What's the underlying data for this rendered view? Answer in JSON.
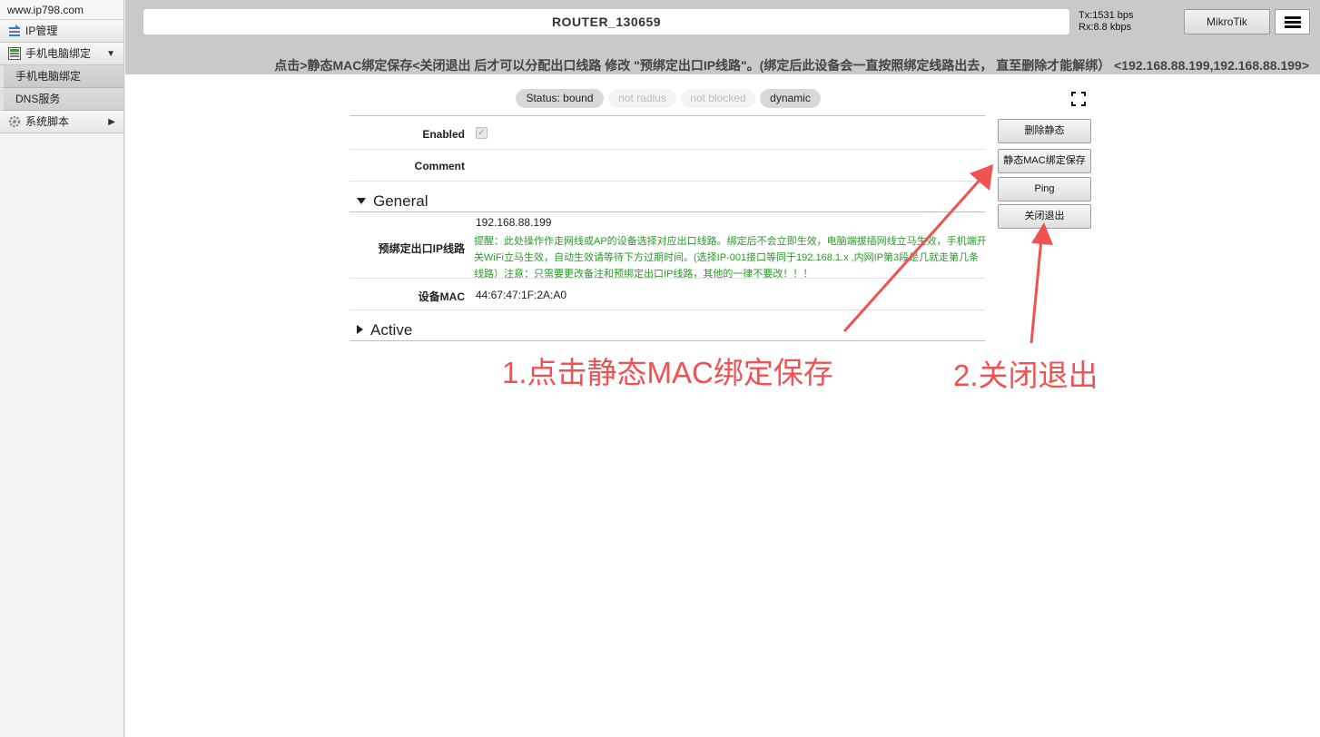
{
  "sidebar": {
    "brand": "www.ip798.com",
    "items": [
      {
        "label": "IP管理"
      },
      {
        "label": "手机电脑绑定",
        "arrow": "▼"
      },
      {
        "label": "系统脚本",
        "arrow": "▶"
      }
    ],
    "subitems": [
      {
        "label": "手机电脑绑定"
      },
      {
        "label": "DNS服务"
      }
    ]
  },
  "header": {
    "router_name": "ROUTER_130659",
    "tx": "Tx:1531 bps",
    "rx": "Rx:8.8 kbps",
    "brand_button": "MikroTik",
    "menu_icon": "hamburger-icon",
    "notice": "点击>静态MAC绑定保存<关闭退出 后才可以分配出口线路 修改 \"预绑定出口IP线路\"。(绑定后此设备会一直按照绑定线路出去， 直至删除才能解绑） <192.168.88.199,192.168.88.199>"
  },
  "status": {
    "pills": [
      {
        "label": "Status: bound",
        "active": true
      },
      {
        "label": "not radius",
        "active": false
      },
      {
        "label": "not blocked",
        "active": false
      },
      {
        "label": "dynamic",
        "active": true
      }
    ]
  },
  "form": {
    "enabled_label": "Enabled",
    "enabled_checked": true,
    "comment_label": "Comment",
    "comment_value": "",
    "general_section": "General",
    "ip_route_label": "预绑定出口IP线路",
    "ip_route_value": "192.168.88.199",
    "ip_route_hint": "提醒：此处操作作走网线或AP的设备选择对应出口线路。绑定后不会立即生效，电脑端拔插网线立马生效，手机端开关WiFi立马生效，自动生效请等待下方过期时间。(选择IP-001接口等同于192.168.1.x ,内网IP第3段是几就走第几条线路）注意：只需要更改备注和预绑定出口IP线路，其他的一律不要改！！！",
    "mac_label": "设备MAC",
    "mac_value": "44:67:47:1F:2A:A0",
    "active_section": "Active"
  },
  "actions": {
    "delete_static": "删除静态",
    "save_static_mac": "静态MAC绑定保存",
    "ping": "Ping",
    "close_exit": "关闭退出"
  },
  "annotations": {
    "step1": "1.点击静态MAC绑定保存",
    "step2": "2.关闭退出",
    "color": "#f05252"
  },
  "colors": {
    "hint_green": "#2a9a2a",
    "topbar_gray": "#c9c9c9"
  }
}
